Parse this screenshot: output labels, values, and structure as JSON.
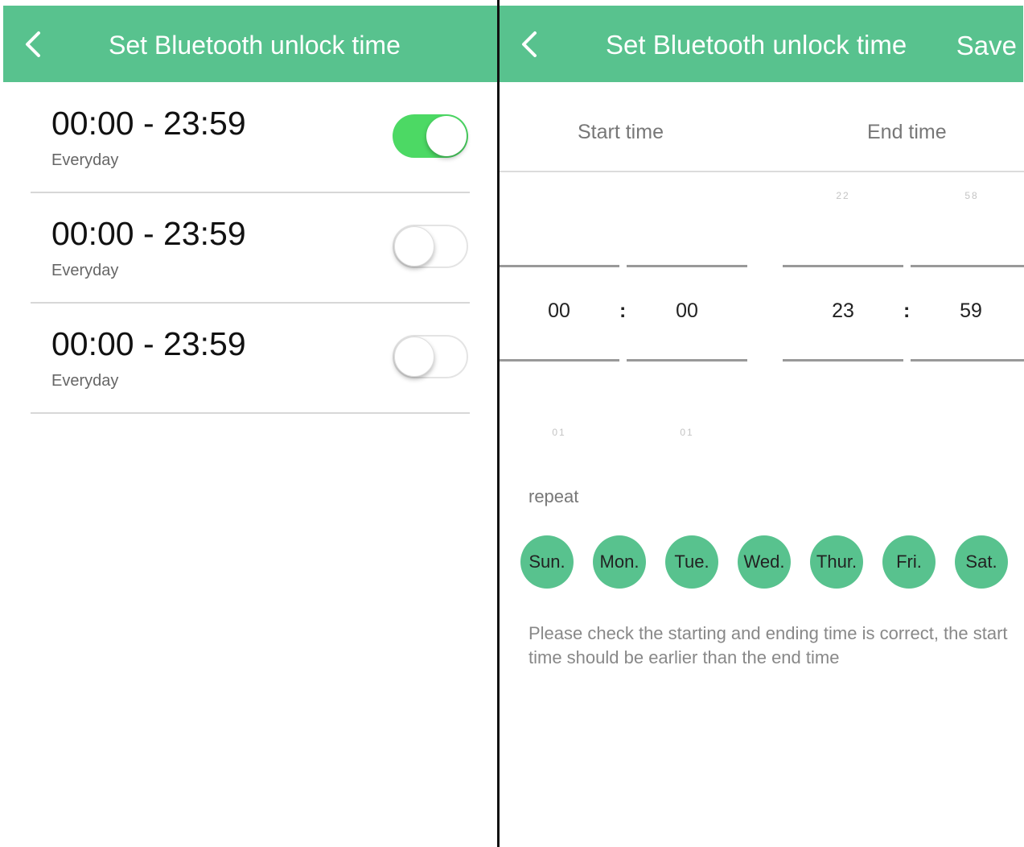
{
  "list_screen": {
    "title": "Set Bluetooth unlock time",
    "schedules": [
      {
        "time_range": "00:00 - 23:59",
        "repeat": "Everyday",
        "enabled": true
      },
      {
        "time_range": "00:00 - 23:59",
        "repeat": "Everyday",
        "enabled": false
      },
      {
        "time_range": "00:00 - 23:59",
        "repeat": "Everyday",
        "enabled": false
      }
    ]
  },
  "edit_screen": {
    "title": "Set Bluetooth unlock time",
    "save_label": "Save",
    "tabs": {
      "start": "Start time",
      "end": "End time"
    },
    "start_picker": {
      "hour": "00",
      "minute": "00",
      "hour_next": "01",
      "minute_next": "01"
    },
    "end_picker": {
      "hour": "23",
      "minute": "59",
      "hour_prev": "22",
      "minute_prev": "58"
    },
    "separator": ":",
    "repeat_label": "repeat",
    "days": [
      "Sun.",
      "Mon.",
      "Tue.",
      "Wed.",
      "Thur.",
      "Fri.",
      "Sat."
    ],
    "notice": "Please check the starting and ending time is correct, the start time should be earlier than the end time"
  },
  "colors": {
    "header": "#58c28e",
    "toggle_on": "#4cd964",
    "day_circle": "#58c28e"
  }
}
